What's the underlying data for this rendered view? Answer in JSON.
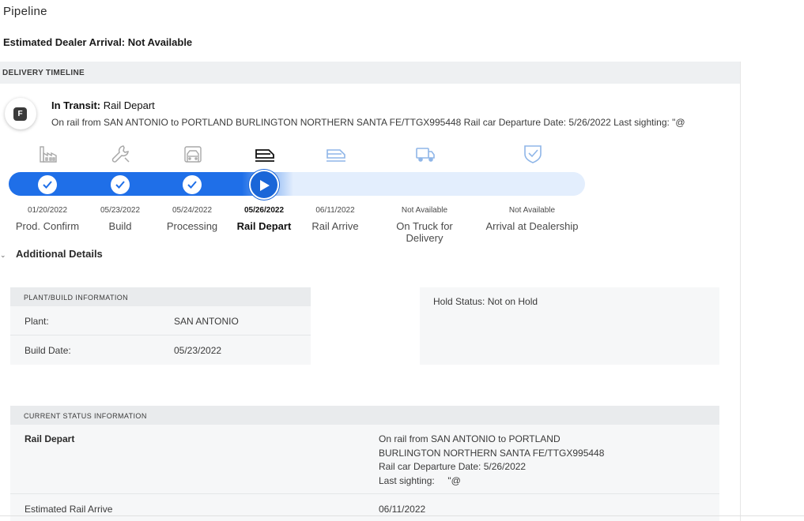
{
  "page": {
    "title": "Pipeline",
    "eta_label": "Estimated Dealer Arrival:",
    "eta_value": "Not Available"
  },
  "timeline": {
    "header": "DELIVERY TIMELINE",
    "badge_letter": "F",
    "status_prefix": "In Transit:",
    "status_value": "Rail Depart",
    "status_description": "On rail from SAN ANTONIO to PORTLAND BURLINGTON NORTHERN SANTA FE/TTGX995448 Rail car Departure Date: 5/26/2022 Last sighting: \"@",
    "progress_fraction": 0.45,
    "steps": [
      {
        "date": "01/20/2022",
        "label": "Prod. Confirm",
        "icon": "factory-icon",
        "state": "complete"
      },
      {
        "date": "05/23/2022",
        "label": "Build",
        "icon": "wrench-icon",
        "state": "complete"
      },
      {
        "date": "05/24/2022",
        "label": "Processing",
        "icon": "processing-icon",
        "state": "complete"
      },
      {
        "date": "05/26/2022",
        "label": "Rail Depart",
        "icon": "rail-car-icon",
        "state": "current"
      },
      {
        "date": "06/11/2022",
        "label": "Rail Arrive",
        "icon": "rail-arrive-icon",
        "state": "pending"
      },
      {
        "date": "Not Available",
        "label": "On Truck for Delivery",
        "icon": "truck-icon",
        "state": "pending"
      },
      {
        "date": "Not Available",
        "label": "Arrival at Dealership",
        "icon": "shield-check-icon",
        "state": "pending"
      }
    ]
  },
  "details": {
    "toggle_label": "Additional Details",
    "plant": {
      "header": "PLANT/BUILD INFORMATION",
      "plant_label": "Plant:",
      "plant_value": "SAN ANTONIO",
      "build_date_label": "Build Date:",
      "build_date_value": "05/23/2022"
    },
    "hold_status": "Hold Status: Not on Hold",
    "current_status": {
      "header": "CURRENT STATUS INFORMATION",
      "status_label": "Rail Depart",
      "status_lines": [
        "On rail from SAN ANTONIO to PORTLAND",
        "BURLINGTON NORTHERN SANTA FE/TTGX995448",
        "Rail car Departure Date: 5/26/2022",
        "Last sighting:     \"@"
      ],
      "eta_label": "Estimated Rail Arrive",
      "eta_value": "06/11/2022"
    }
  },
  "colors": {
    "accent_blue": "#1f6fe8",
    "track_light": "#e3eefd",
    "pending_icon": "#8fb6e8",
    "complete_icon": "#a8a8a8"
  }
}
